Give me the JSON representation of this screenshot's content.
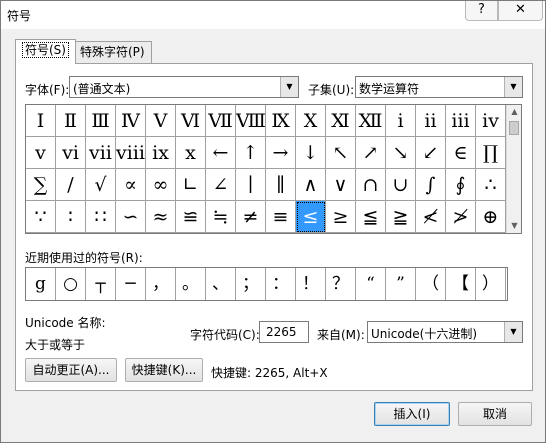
{
  "window": {
    "title": "符号",
    "help_label": "?",
    "close_label": "✕"
  },
  "tabs": [
    {
      "label": "符号(S)"
    },
    {
      "label": "特殊字符(P)"
    }
  ],
  "font": {
    "label": "字体(F):",
    "value": "(普通文本)"
  },
  "subset": {
    "label": "子集(U):",
    "value": "数学运算符"
  },
  "symbols": [
    "Ⅰ",
    "Ⅱ",
    "Ⅲ",
    "Ⅳ",
    "Ⅴ",
    "Ⅵ",
    "Ⅶ",
    "Ⅷ",
    "Ⅸ",
    "Ⅹ",
    "Ⅺ",
    "Ⅻ",
    "ⅰ",
    "ⅱ",
    "ⅲ",
    "ⅳ",
    "ⅴ",
    "ⅵ",
    "ⅶ",
    "ⅷ",
    "ⅸ",
    "ⅹ",
    "←",
    "↑",
    "→",
    "↓",
    "↖",
    "↗",
    "↘",
    "↙",
    "∈",
    "∏",
    "∑",
    "∕",
    "√",
    "∝",
    "∞",
    "∟",
    "∠",
    "∣",
    "∥",
    "∧",
    "∨",
    "∩",
    "∪",
    "∫",
    "∮",
    "∴",
    "∵",
    "∶",
    "∷",
    "∽",
    "≈",
    "≌",
    "≒",
    "≠",
    "≡",
    "≤",
    "≥",
    "≦",
    "≧",
    "≮",
    "≯",
    "⊕"
  ],
  "selected_symbol_index": 57,
  "recent": {
    "label": "近期使用过的符号(R):",
    "items": [
      "g",
      "○",
      "┬",
      "─",
      "，",
      "。",
      "、",
      "；",
      "：",
      "！",
      "？",
      "“",
      "”",
      "（",
      "【",
      "）"
    ]
  },
  "unicode_name": {
    "label": "Unicode 名称:",
    "value": "大于或等于"
  },
  "char_code": {
    "label": "字符代码(C):",
    "value": "2265"
  },
  "from": {
    "label": "来自(M):",
    "value": "Unicode(十六进制)"
  },
  "buttons": {
    "autocorrect": "自动更正(A)...",
    "shortcut_key": "快捷键(K)...",
    "shortcut_text": "快捷键: 2265, Alt+X",
    "insert": "插入(I)",
    "cancel": "取消"
  }
}
